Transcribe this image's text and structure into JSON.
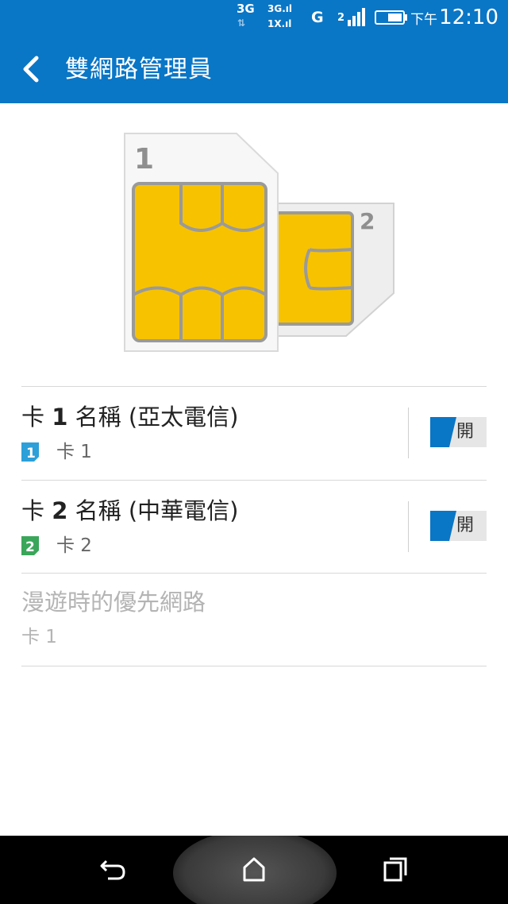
{
  "status_bar": {
    "network_3g": "3G",
    "network_arrows": "⇅",
    "network_3g_small": "3G.ıl",
    "network_1x": "1X.ıl",
    "network_g": "G",
    "sim2_indicator": "2",
    "ampm": "下午",
    "time": "12:10",
    "icons": [
      "signal-bars-icon",
      "battery-icon"
    ]
  },
  "app_bar": {
    "title": "雙網路管理員",
    "back_icon": "back-arrow-icon"
  },
  "hero": {
    "sim1_number": "1",
    "sim2_number": "2"
  },
  "rows": [
    {
      "title_prefix": "卡 ",
      "title_num": "1",
      "title_suffix": " 名稱 (亞太電信)",
      "badge_digit": "1",
      "badge_color": "#2d9fd9",
      "subtitle": "卡 1",
      "toggle_label": "開",
      "toggle_color": "#0a76c6"
    },
    {
      "title_prefix": "卡 ",
      "title_num": "2",
      "title_suffix": " 名稱 (中華電信)",
      "badge_digit": "2",
      "badge_color": "#3aa65a",
      "subtitle": "卡 2",
      "toggle_label": "開",
      "toggle_color": "#0a76c6"
    }
  ],
  "roaming": {
    "title": "漫遊時的優先網路",
    "subtitle": "卡 1"
  },
  "nav_bar": {
    "icons": [
      "back-icon",
      "home-icon",
      "recents-icon"
    ]
  },
  "colors": {
    "primary": "#0a76c6",
    "sim_chip": "#f7c200"
  }
}
